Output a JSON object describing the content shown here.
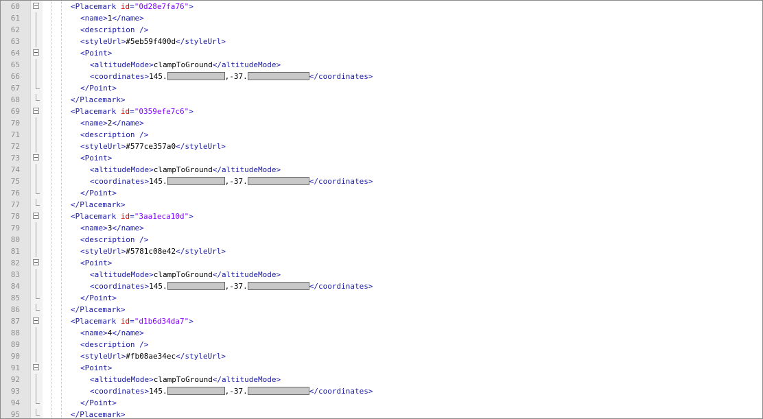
{
  "editor": {
    "colors": {
      "tag": "#1a1aa6",
      "attribute": "#e00000",
      "attribute_value": "#8000ff",
      "text": "#000000",
      "line_number": "#8d8d8d",
      "gutter": "#e4e4e4"
    },
    "lines": [
      {
        "n": "60",
        "indent": 2,
        "fold": "box",
        "parts": [
          {
            "t": "tag",
            "v": "<Placemark "
          },
          {
            "t": "attr",
            "v": "id"
          },
          {
            "t": "tag",
            "v": "="
          },
          {
            "t": "val",
            "v": "\"0d28e7fa76\""
          },
          {
            "t": "tag",
            "v": ">"
          }
        ]
      },
      {
        "n": "61",
        "indent": 3,
        "fold": "line",
        "parts": [
          {
            "t": "tag",
            "v": "<name>"
          },
          {
            "t": "txt",
            "v": "1"
          },
          {
            "t": "tag",
            "v": "</name>"
          }
        ]
      },
      {
        "n": "62",
        "indent": 3,
        "fold": "line",
        "parts": [
          {
            "t": "tag",
            "v": "<description />"
          }
        ]
      },
      {
        "n": "63",
        "indent": 3,
        "fold": "line",
        "parts": [
          {
            "t": "tag",
            "v": "<styleUrl>"
          },
          {
            "t": "txt",
            "v": "#5eb59f400d"
          },
          {
            "t": "tag",
            "v": "</styleUrl>"
          }
        ]
      },
      {
        "n": "64",
        "indent": 3,
        "fold": "box",
        "parts": [
          {
            "t": "tag",
            "v": "<Point>"
          }
        ]
      },
      {
        "n": "65",
        "indent": 4,
        "fold": "line",
        "parts": [
          {
            "t": "tag",
            "v": "<altitudeMode>"
          },
          {
            "t": "txt",
            "v": "clampToGround"
          },
          {
            "t": "tag",
            "v": "</altitudeMode>"
          }
        ]
      },
      {
        "n": "66",
        "indent": 4,
        "fold": "line",
        "parts": [
          {
            "t": "tag",
            "v": "<coordinates>"
          },
          {
            "t": "txt",
            "v": "145."
          },
          {
            "t": "redact"
          },
          {
            "t": "txt",
            "v": ",-37."
          },
          {
            "t": "redact"
          },
          {
            "t": "tag",
            "v": "</coordinates>"
          }
        ]
      },
      {
        "n": "67",
        "indent": 3,
        "fold": "end",
        "parts": [
          {
            "t": "tag",
            "v": "</Point>"
          }
        ]
      },
      {
        "n": "68",
        "indent": 2,
        "fold": "end",
        "parts": [
          {
            "t": "tag",
            "v": "</Placemark>"
          }
        ]
      },
      {
        "n": "69",
        "indent": 2,
        "fold": "box",
        "parts": [
          {
            "t": "tag",
            "v": "<Placemark "
          },
          {
            "t": "attr",
            "v": "id"
          },
          {
            "t": "tag",
            "v": "="
          },
          {
            "t": "val",
            "v": "\"0359efe7c6\""
          },
          {
            "t": "tag",
            "v": ">"
          }
        ]
      },
      {
        "n": "70",
        "indent": 3,
        "fold": "line",
        "parts": [
          {
            "t": "tag",
            "v": "<name>"
          },
          {
            "t": "txt",
            "v": "2"
          },
          {
            "t": "tag",
            "v": "</name>"
          }
        ]
      },
      {
        "n": "71",
        "indent": 3,
        "fold": "line",
        "parts": [
          {
            "t": "tag",
            "v": "<description />"
          }
        ]
      },
      {
        "n": "72",
        "indent": 3,
        "fold": "line",
        "parts": [
          {
            "t": "tag",
            "v": "<styleUrl>"
          },
          {
            "t": "txt",
            "v": "#577ce357a0"
          },
          {
            "t": "tag",
            "v": "</styleUrl>"
          }
        ]
      },
      {
        "n": "73",
        "indent": 3,
        "fold": "box",
        "parts": [
          {
            "t": "tag",
            "v": "<Point>"
          }
        ]
      },
      {
        "n": "74",
        "indent": 4,
        "fold": "line",
        "parts": [
          {
            "t": "tag",
            "v": "<altitudeMode>"
          },
          {
            "t": "txt",
            "v": "clampToGround"
          },
          {
            "t": "tag",
            "v": "</altitudeMode>"
          }
        ]
      },
      {
        "n": "75",
        "indent": 4,
        "fold": "line",
        "parts": [
          {
            "t": "tag",
            "v": "<coordinates>"
          },
          {
            "t": "txt",
            "v": "145."
          },
          {
            "t": "redact"
          },
          {
            "t": "txt",
            "v": ",-37."
          },
          {
            "t": "redact"
          },
          {
            "t": "tag",
            "v": "</coordinates>"
          }
        ]
      },
      {
        "n": "76",
        "indent": 3,
        "fold": "end",
        "parts": [
          {
            "t": "tag",
            "v": "</Point>"
          }
        ]
      },
      {
        "n": "77",
        "indent": 2,
        "fold": "end",
        "parts": [
          {
            "t": "tag",
            "v": "</Placemark>"
          }
        ]
      },
      {
        "n": "78",
        "indent": 2,
        "fold": "box",
        "parts": [
          {
            "t": "tag",
            "v": "<Placemark "
          },
          {
            "t": "attr",
            "v": "id"
          },
          {
            "t": "tag",
            "v": "="
          },
          {
            "t": "val",
            "v": "\"3aa1eca10d\""
          },
          {
            "t": "tag",
            "v": ">"
          }
        ]
      },
      {
        "n": "79",
        "indent": 3,
        "fold": "line",
        "parts": [
          {
            "t": "tag",
            "v": "<name>"
          },
          {
            "t": "txt",
            "v": "3"
          },
          {
            "t": "tag",
            "v": "</name>"
          }
        ]
      },
      {
        "n": "80",
        "indent": 3,
        "fold": "line",
        "parts": [
          {
            "t": "tag",
            "v": "<description />"
          }
        ]
      },
      {
        "n": "81",
        "indent": 3,
        "fold": "line",
        "parts": [
          {
            "t": "tag",
            "v": "<styleUrl>"
          },
          {
            "t": "txt",
            "v": "#5781c08e42"
          },
          {
            "t": "tag",
            "v": "</styleUrl>"
          }
        ]
      },
      {
        "n": "82",
        "indent": 3,
        "fold": "box",
        "parts": [
          {
            "t": "tag",
            "v": "<Point>"
          }
        ]
      },
      {
        "n": "83",
        "indent": 4,
        "fold": "line",
        "parts": [
          {
            "t": "tag",
            "v": "<altitudeMode>"
          },
          {
            "t": "txt",
            "v": "clampToGround"
          },
          {
            "t": "tag",
            "v": "</altitudeMode>"
          }
        ]
      },
      {
        "n": "84",
        "indent": 4,
        "fold": "line",
        "parts": [
          {
            "t": "tag",
            "v": "<coordinates>"
          },
          {
            "t": "txt",
            "v": "145."
          },
          {
            "t": "redact"
          },
          {
            "t": "txt",
            "v": ",-37."
          },
          {
            "t": "redact"
          },
          {
            "t": "tag",
            "v": "</coordinates>"
          }
        ]
      },
      {
        "n": "85",
        "indent": 3,
        "fold": "end",
        "parts": [
          {
            "t": "tag",
            "v": "</Point>"
          }
        ]
      },
      {
        "n": "86",
        "indent": 2,
        "fold": "end",
        "parts": [
          {
            "t": "tag",
            "v": "</Placemark>"
          }
        ]
      },
      {
        "n": "87",
        "indent": 2,
        "fold": "box",
        "parts": [
          {
            "t": "tag",
            "v": "<Placemark "
          },
          {
            "t": "attr",
            "v": "id"
          },
          {
            "t": "tag",
            "v": "="
          },
          {
            "t": "val",
            "v": "\"d1b6d34da7\""
          },
          {
            "t": "tag",
            "v": ">"
          }
        ]
      },
      {
        "n": "88",
        "indent": 3,
        "fold": "line",
        "parts": [
          {
            "t": "tag",
            "v": "<name>"
          },
          {
            "t": "txt",
            "v": "4"
          },
          {
            "t": "tag",
            "v": "</name>"
          }
        ]
      },
      {
        "n": "89",
        "indent": 3,
        "fold": "line",
        "parts": [
          {
            "t": "tag",
            "v": "<description />"
          }
        ]
      },
      {
        "n": "90",
        "indent": 3,
        "fold": "line",
        "parts": [
          {
            "t": "tag",
            "v": "<styleUrl>"
          },
          {
            "t": "txt",
            "v": "#fb08ae34ec"
          },
          {
            "t": "tag",
            "v": "</styleUrl>"
          }
        ]
      },
      {
        "n": "91",
        "indent": 3,
        "fold": "box",
        "parts": [
          {
            "t": "tag",
            "v": "<Point>"
          }
        ]
      },
      {
        "n": "92",
        "indent": 4,
        "fold": "line",
        "parts": [
          {
            "t": "tag",
            "v": "<altitudeMode>"
          },
          {
            "t": "txt",
            "v": "clampToGround"
          },
          {
            "t": "tag",
            "v": "</altitudeMode>"
          }
        ]
      },
      {
        "n": "93",
        "indent": 4,
        "fold": "line",
        "parts": [
          {
            "t": "tag",
            "v": "<coordinates>"
          },
          {
            "t": "txt",
            "v": "145."
          },
          {
            "t": "redact"
          },
          {
            "t": "txt",
            "v": ",-37."
          },
          {
            "t": "redact"
          },
          {
            "t": "tag",
            "v": "</coordinates>"
          }
        ]
      },
      {
        "n": "94",
        "indent": 3,
        "fold": "end",
        "parts": [
          {
            "t": "tag",
            "v": "</Point>"
          }
        ]
      },
      {
        "n": "95",
        "indent": 2,
        "fold": "end",
        "parts": [
          {
            "t": "tag",
            "v": "</Placemark>"
          }
        ]
      }
    ]
  }
}
